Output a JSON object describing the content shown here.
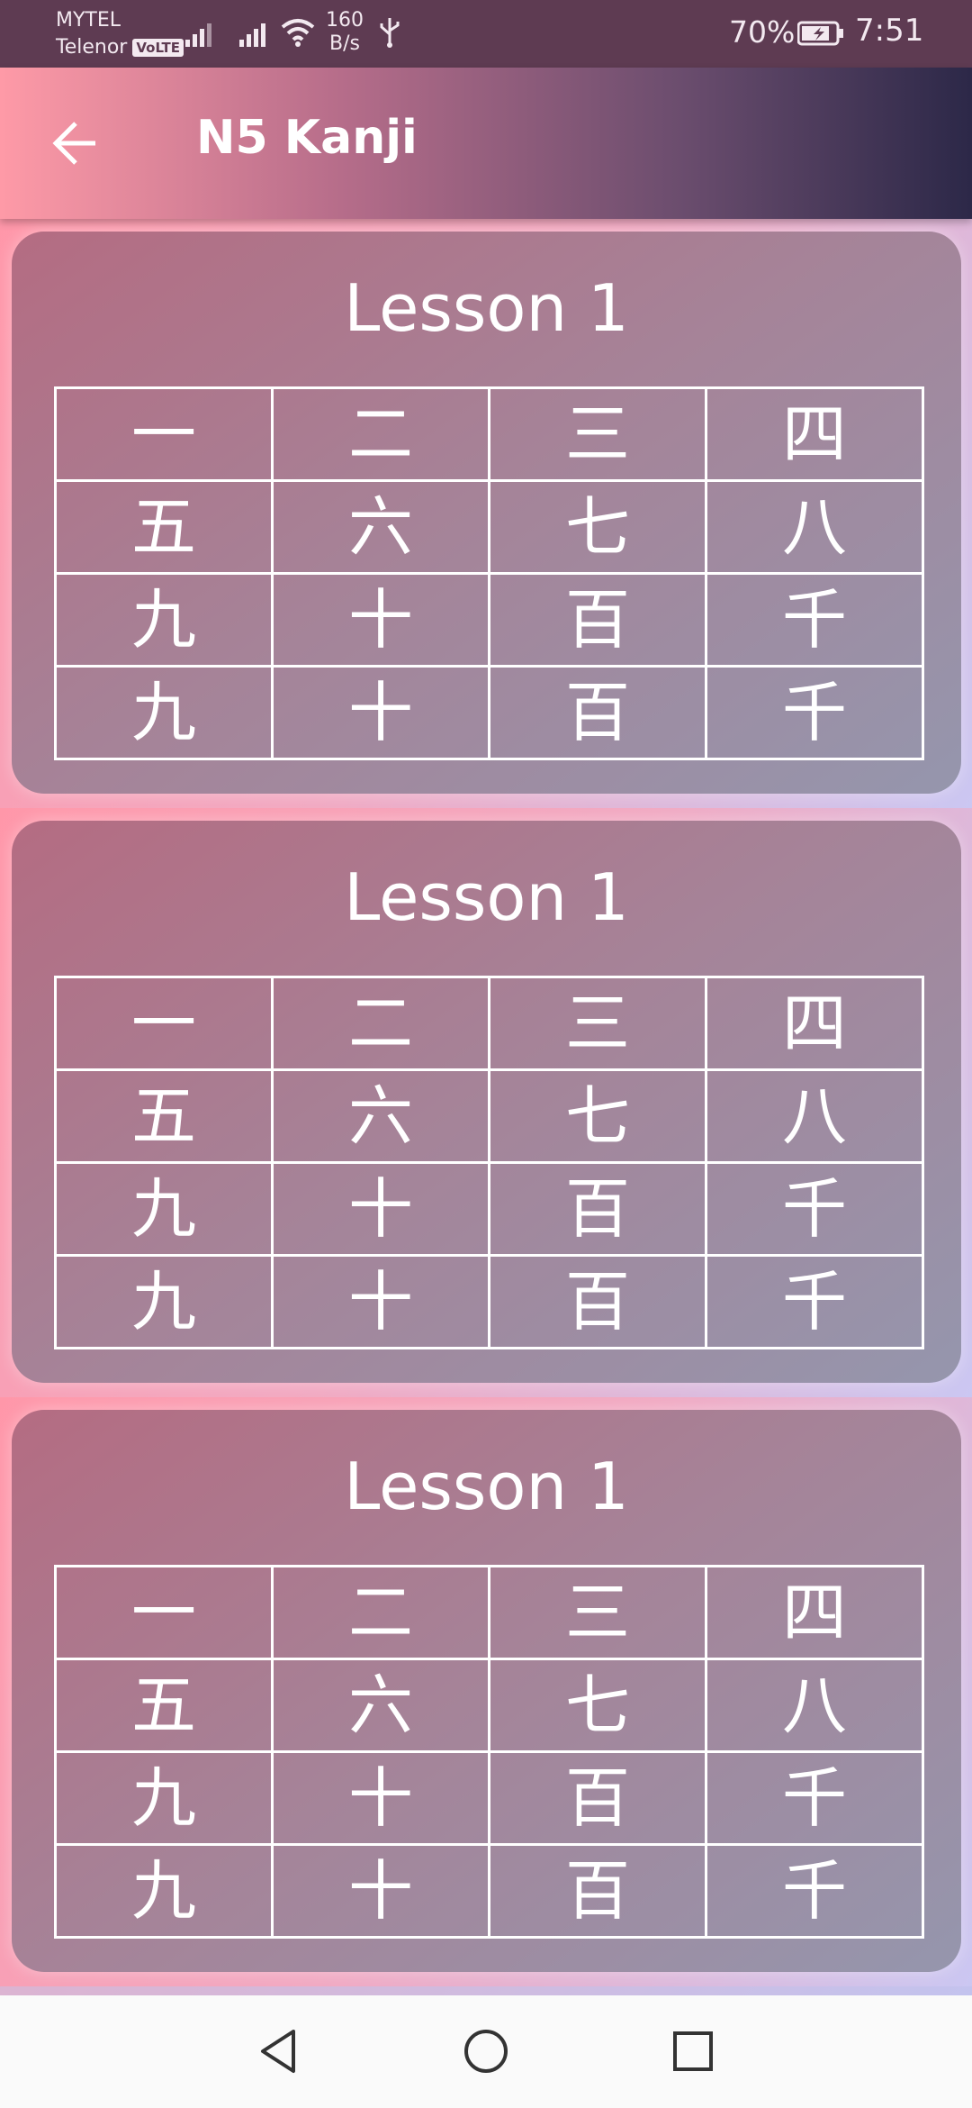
{
  "status_bar": {
    "carrier_primary": "MYTEL",
    "carrier_secondary": "Telenor",
    "volte": "VoLTE",
    "net_speed_value": "160",
    "net_speed_unit": "B/s",
    "battery_percent": "70%",
    "time": "7:51"
  },
  "app_bar": {
    "title": "N5 Kanji"
  },
  "lessons": [
    {
      "title": "Lesson 1",
      "rows": [
        [
          "一",
          "二",
          "三",
          "四"
        ],
        [
          "五",
          "六",
          "七",
          "八"
        ],
        [
          "九",
          "十",
          "百",
          "千"
        ],
        [
          "九",
          "十",
          "百",
          "千"
        ]
      ]
    },
    {
      "title": "Lesson 1",
      "rows": [
        [
          "一",
          "二",
          "三",
          "四"
        ],
        [
          "五",
          "六",
          "七",
          "八"
        ],
        [
          "九",
          "十",
          "百",
          "千"
        ],
        [
          "九",
          "十",
          "百",
          "千"
        ]
      ]
    },
    {
      "title": "Lesson 1",
      "rows": [
        [
          "一",
          "二",
          "三",
          "四"
        ],
        [
          "五",
          "六",
          "七",
          "八"
        ],
        [
          "九",
          "十",
          "百",
          "千"
        ],
        [
          "九",
          "十",
          "百",
          "千"
        ]
      ]
    }
  ],
  "icons": {
    "back": "back-arrow-icon",
    "nav_back": "triangle-back-icon",
    "nav_home": "circle-home-icon",
    "nav_recents": "square-recents-icon"
  },
  "colors": {
    "app_bar_start": "#fe9aa7",
    "app_bar_end": "#2c2848",
    "card": "#a58499",
    "text": "#ffffff"
  }
}
